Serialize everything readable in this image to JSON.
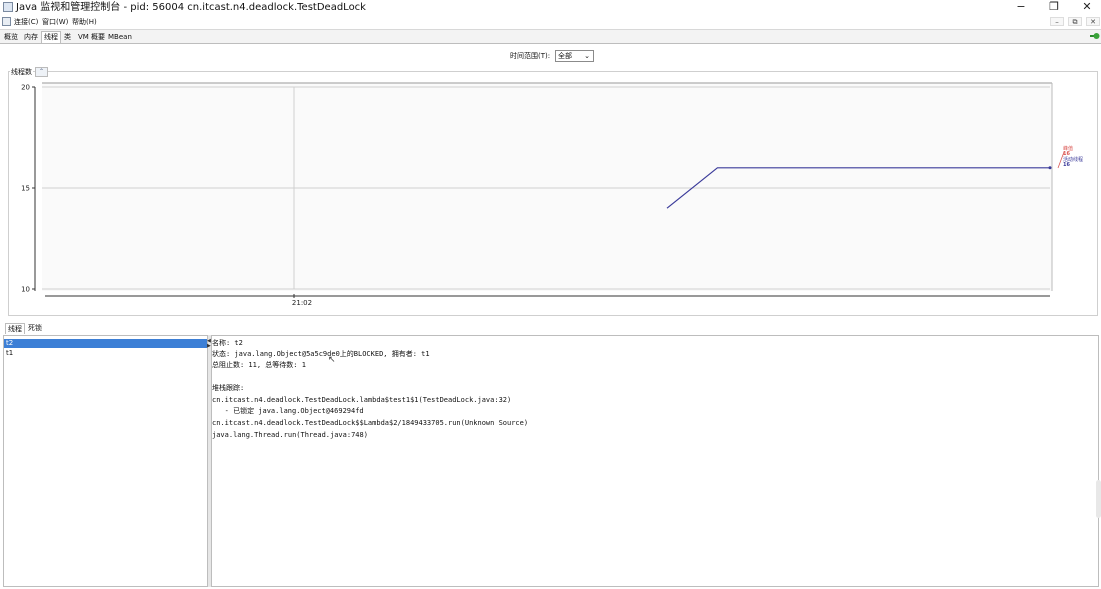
{
  "window": {
    "title": "Java 监视和管理控制台 - pid: 56004 cn.itcast.n4.deadlock.TestDeadLock",
    "controls": {
      "minimize": "−",
      "restore": "❐",
      "close": "✕"
    },
    "inner_controls": {
      "minimize": "–",
      "restore": "⧉",
      "close": "✕"
    }
  },
  "menu": {
    "items": [
      {
        "label": "连接(C)"
      },
      {
        "label": "窗口(W)"
      },
      {
        "label": "帮助(H)"
      }
    ]
  },
  "tabs": [
    {
      "label": "概览"
    },
    {
      "label": "内存"
    },
    {
      "label": "线程",
      "active": true
    },
    {
      "label": "类"
    },
    {
      "label": "VM 概要"
    },
    {
      "label": "MBean"
    }
  ],
  "time_range": {
    "label": "时间范围(T):",
    "value": "全部"
  },
  "chart": {
    "panel_title": "线程数",
    "expand_icon": "⌃",
    "legend": [
      {
        "label": "峰值",
        "value": "16",
        "color": "#d9534f"
      },
      {
        "label": "活动线程",
        "value": "16",
        "color": "#3b3b9a"
      }
    ]
  },
  "chart_data": {
    "type": "line",
    "title": "",
    "xlabel": "",
    "ylabel": "",
    "ylim": [
      10,
      20
    ],
    "yticks": [
      "10",
      "15",
      "20"
    ],
    "xticks": [
      "21:02"
    ],
    "grid": true,
    "series": [
      {
        "name": "活动线程",
        "color": "#3b3b9a",
        "points": [
          [
            0.62,
            14
          ],
          [
            0.67,
            16
          ],
          [
            1.0,
            16
          ]
        ]
      }
    ]
  },
  "subtabs": [
    {
      "label": "线程",
      "active": true
    },
    {
      "label": "死锁"
    }
  ],
  "threads": [
    {
      "name": "t2",
      "selected": true
    },
    {
      "name": "t1",
      "selected": false
    }
  ],
  "details": {
    "name_line": "名称: t2",
    "state_line": "状态: java.lang.Object@5a5c9de0上的BLOCKED, 拥有者: t1",
    "counts_line": "总阻止数: 11, 总等待数: 1",
    "stack_header": "堆栈跟踪:",
    "stack": [
      "cn.itcast.n4.deadlock.TestDeadLock.lambda$test1$1(TestDeadLock.java:32)",
      "   - 已锁定 java.lang.Object@469294fd",
      "cn.itcast.n4.deadlock.TestDeadLock$$Lambda$2/1849433705.run(Unknown Source)",
      "java.lang.Thread.run(Thread.java:748)"
    ]
  },
  "colors": {
    "selection": "#3c7fd6",
    "series": "#3b3b9a"
  }
}
